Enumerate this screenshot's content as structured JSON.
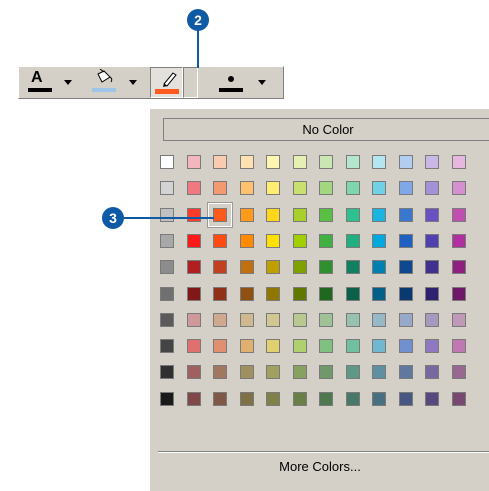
{
  "callouts": {
    "step2": "2",
    "step3": "3"
  },
  "toolbar": {
    "buttons": [
      {
        "icon": "text-color-icon",
        "glyph": "A",
        "bar_color": "#000000"
      },
      {
        "icon": "fill-color-icon",
        "bar_color": "#9fc4ea"
      },
      {
        "icon": "line-color-icon",
        "bar_color": "#ff5a1e"
      },
      {
        "icon": "marker-color-icon",
        "bar_color": "#000000"
      }
    ]
  },
  "palette": {
    "no_color_label": "No Color",
    "more_colors_label": "More Colors...",
    "selected": {
      "row": 2,
      "col": 2
    },
    "colors": [
      [
        "#ffffff",
        "#f2b6bc",
        "#f9cbb0",
        "#ffe0b3",
        "#fff5b3",
        "#e6f0b3",
        "#c9e6b3",
        "#b3e6cc",
        "#b3e6f0",
        "#b3cdf0",
        "#c9b8e6",
        "#e6b8e0"
      ],
      [
        "#d3d3d3",
        "#f07880",
        "#f49a70",
        "#ffc070",
        "#ffec70",
        "#c9e070",
        "#a3d680",
        "#7fd6ad",
        "#70d0e6",
        "#7fa8e6",
        "#a490d6",
        "#d690d0"
      ],
      [
        "#c0c0c0",
        "#ff3a2a",
        "#ff5a1e",
        "#ff9a1a",
        "#ffd61a",
        "#a8d02a",
        "#58bf44",
        "#2fc090",
        "#1ab4e0",
        "#3a78d0",
        "#6a50c0",
        "#c050b0"
      ],
      [
        "#a8a8a8",
        "#ff1a1a",
        "#ff4a10",
        "#ff8a00",
        "#ffe000",
        "#a0d000",
        "#40b040",
        "#20b080",
        "#00a8e0",
        "#2060c0",
        "#5040b0",
        "#b030a0"
      ],
      [
        "#8c8c8c",
        "#b02020",
        "#c04020",
        "#c07010",
        "#c0a000",
        "#80a000",
        "#309030",
        "#108060",
        "#0080b0",
        "#104890",
        "#403090",
        "#902080"
      ],
      [
        "#707070",
        "#801818",
        "#903018",
        "#905010",
        "#907800",
        "#607800",
        "#206820",
        "#0a6048",
        "#006088",
        "#0a3870",
        "#302070",
        "#701868"
      ],
      [
        "#5a5a5a",
        "#d09898",
        "#d0a890",
        "#d0b890",
        "#d0c890",
        "#b8c890",
        "#a0c098",
        "#98c0b0",
        "#98b8c8",
        "#98a8c8",
        "#a898c0",
        "#c098b8"
      ],
      [
        "#444444",
        "#e07070",
        "#e09070",
        "#e0b070",
        "#e0d070",
        "#b0d070",
        "#80c080",
        "#70c0a0",
        "#70b8d0",
        "#7090d0",
        "#9078c0",
        "#c078b0"
      ],
      [
        "#303030",
        "#a06060",
        "#a07860",
        "#a09060",
        "#a0a060",
        "#88a060",
        "#70986a",
        "#609888",
        "#6090a0",
        "#6078a0",
        "#7868a0",
        "#986890"
      ],
      [
        "#1a1a1a",
        "#804848",
        "#805848",
        "#807048",
        "#808048",
        "#688048",
        "#507850",
        "#487868",
        "#487080",
        "#485880",
        "#584880",
        "#784870"
      ]
    ]
  }
}
